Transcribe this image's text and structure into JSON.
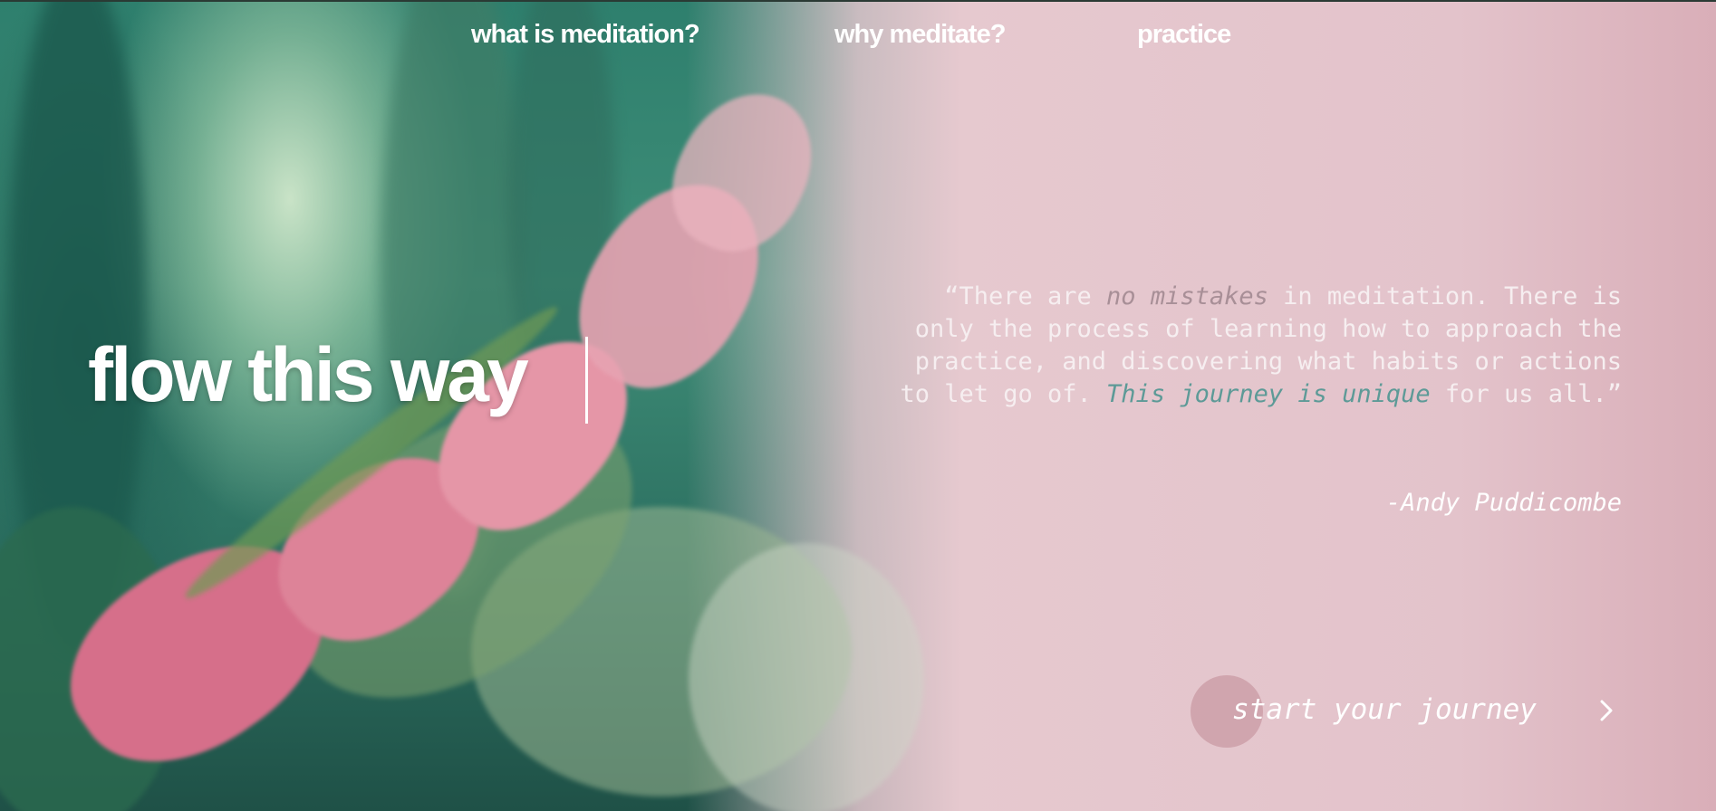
{
  "nav": {
    "items": [
      {
        "label": "what is meditation?"
      },
      {
        "label": "why meditate?"
      },
      {
        "label": "practice"
      }
    ]
  },
  "hero": {
    "title": "flow this way"
  },
  "quote": {
    "part1": "“There are ",
    "part2": "no mistakes",
    "part3": " in meditation. There is only the process of learning how to approach the practice, and discovering what habits or actions to let go of. ",
    "part4": "This journey is unique",
    "part5": " for us all.”",
    "author": "-Andy Puddicombe"
  },
  "cta": {
    "label": "start your journey",
    "icon": "chevron-right-icon"
  },
  "colors": {
    "accent_teal": "#5d9a97",
    "pink_background": "#e3c4cc",
    "text_light": "#f6eef0"
  }
}
